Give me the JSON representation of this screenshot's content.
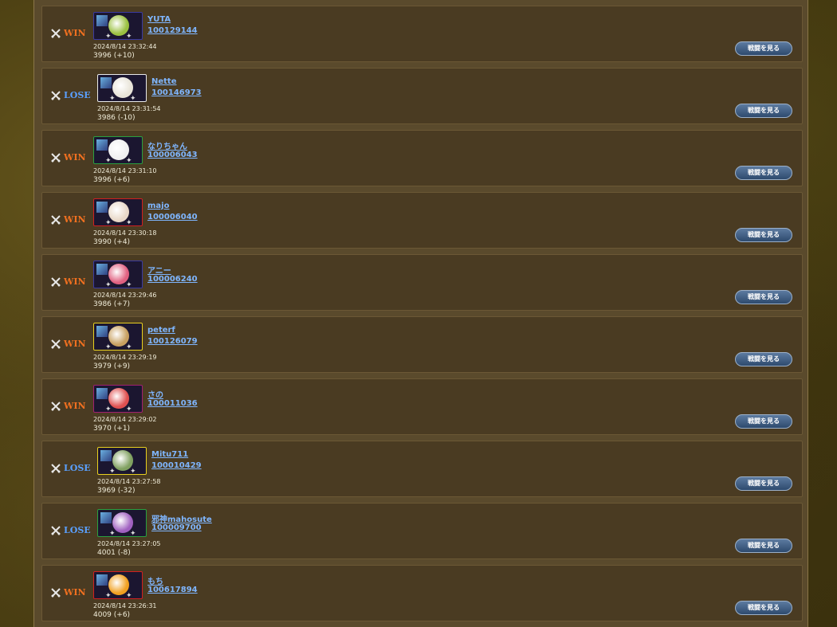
{
  "button_label": "戦闘を見る",
  "colors": {
    "win": "#f07020",
    "lose": "#5aa0ff",
    "link": "#7fb6ff"
  },
  "battles": [
    {
      "result": "WIN",
      "name": "YUTA",
      "user_id": "100129144",
      "datetime": "2024/8/14 23:32:44",
      "score": "3996 (+10)",
      "frame_color": "#3a3aa0"
    },
    {
      "result": "LOSE",
      "name": "Nette",
      "user_id": "100146973",
      "datetime": "2024/8/14 23:31:54",
      "score": "3986 (-10)",
      "frame_color": "#e8e8e8"
    },
    {
      "result": "WIN",
      "name": "なりちゃん",
      "user_id": "100006043",
      "datetime": "2024/8/14 23:31:10",
      "score": "3996 (+6)",
      "frame_color": "#2aa040"
    },
    {
      "result": "WIN",
      "name": "majo",
      "user_id": "100006040",
      "datetime": "2024/8/14 23:30:18",
      "score": "3990 (+4)",
      "frame_color": "#d02020"
    },
    {
      "result": "WIN",
      "name": "アニー",
      "user_id": "100006240",
      "datetime": "2024/8/14 23:29:46",
      "score": "3986 (+7)",
      "frame_color": "#3a3aa0"
    },
    {
      "result": "WIN",
      "name": "peterf",
      "user_id": "100126079",
      "datetime": "2024/8/14 23:29:19",
      "score": "3979 (+9)",
      "frame_color": "#e8d020"
    },
    {
      "result": "WIN",
      "name": "さの",
      "user_id": "100011036",
      "datetime": "2024/8/14 23:29:02",
      "score": "3970 (+1)",
      "frame_color": "#a02070"
    },
    {
      "result": "LOSE",
      "name": "Mitu711",
      "user_id": "100010429",
      "datetime": "2024/8/14 23:27:58",
      "score": "3969 (-32)",
      "frame_color": "#e8d020"
    },
    {
      "result": "LOSE",
      "name": "邪神mahosute",
      "user_id": "100009700",
      "datetime": "2024/8/14 23:27:05",
      "score": "4001 (-8)",
      "frame_color": "#2aa040"
    },
    {
      "result": "WIN",
      "name": "もち",
      "user_id": "100617894",
      "datetime": "2024/8/14 23:26:31",
      "score": "4009 (+6)",
      "frame_color": "#d02020"
    }
  ]
}
